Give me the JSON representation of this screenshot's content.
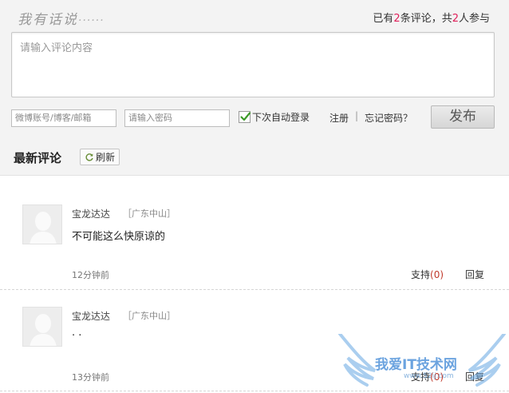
{
  "header": {
    "brand": "我有话说",
    "brand_dots": "······",
    "stats_prefix": "已有",
    "comment_count": "2",
    "stats_mid": "条评论，共",
    "participant_count": "2",
    "stats_suffix": "人参与"
  },
  "form": {
    "comment_placeholder": "请输入评论内容",
    "account_placeholder": "微博账号/博客/邮箱",
    "password_placeholder": "请输入密码",
    "auto_login_label": "下次自动登录",
    "auto_login_checked": true,
    "register_label": "注册",
    "separator": "|",
    "forgot_label": "忘记密码？",
    "publish_label": "发布"
  },
  "list": {
    "title": "最新评论",
    "refresh_label": "刷新"
  },
  "comments": [
    {
      "user": "宝龙达达",
      "location": "［广东中山］",
      "text": "不可能这么快原谅的",
      "time": "12分钟前",
      "support_label": "支持",
      "support_count": "(0)",
      "reply_label": "回复"
    },
    {
      "user": "宝龙达达",
      "location": "［广东中山］",
      "text": "· ·",
      "time": "13分钟前",
      "support_label": "支持",
      "support_count": "(0)",
      "reply_label": "回复"
    }
  ],
  "watermark": {
    "text": "我爱IT技术网",
    "url": "www.52ij.com"
  },
  "colors": {
    "accent": "#e0205a",
    "count": "#c0392b",
    "panel_bg": "#f3f3f3"
  }
}
